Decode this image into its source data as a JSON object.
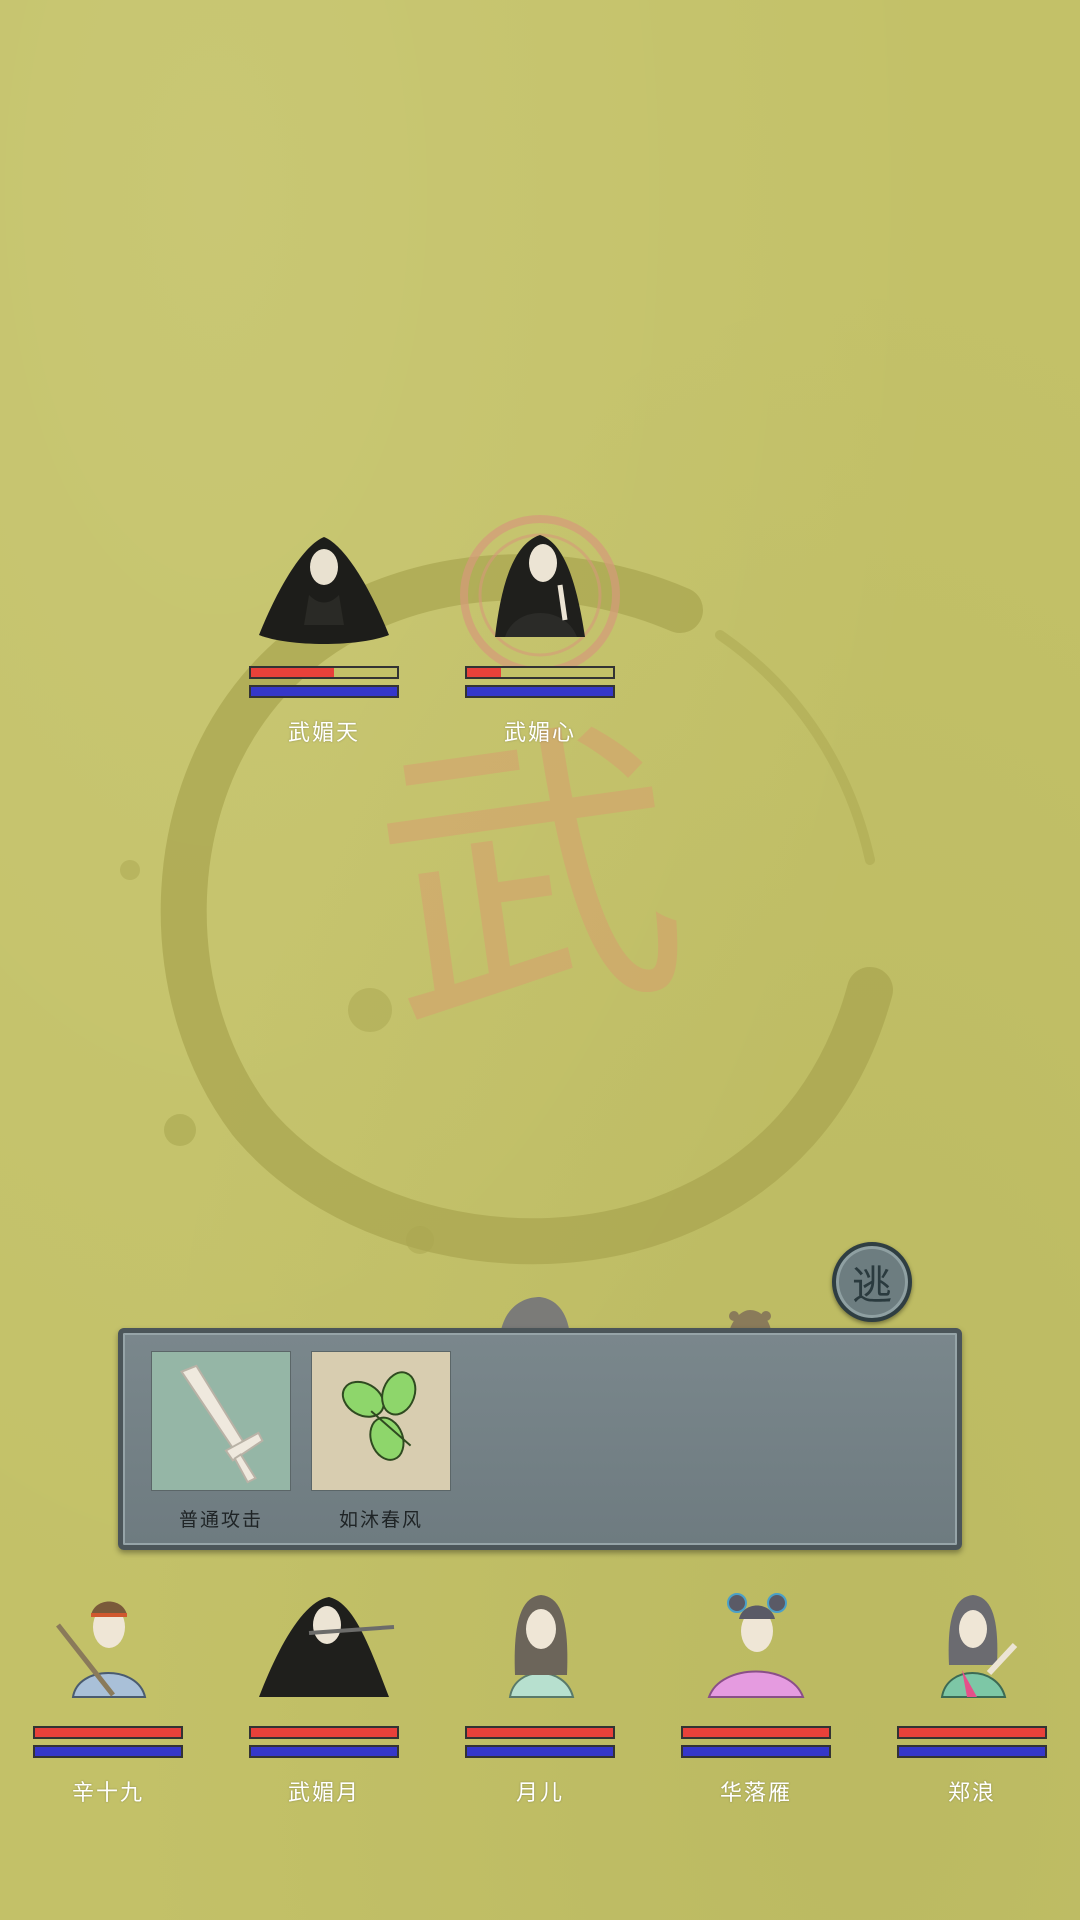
{
  "enemies": [
    {
      "name": "武媚天",
      "hp": 0.57,
      "mp": 1.0,
      "portrait": "veiled-woman-black-hair-portrait"
    },
    {
      "name": "武媚心",
      "hp": 0.23,
      "mp": 1.0,
      "portrait": "long-black-hair-woman-portrait"
    }
  ],
  "party": [
    {
      "name": "辛十九",
      "hp": 1.0,
      "mp": 1.0,
      "portrait": "swordsman-headband-portrait"
    },
    {
      "name": "武媚月",
      "hp": 1.0,
      "mp": 1.0,
      "portrait": "flute-player-black-robe-portrait"
    },
    {
      "name": "月儿",
      "hp": 1.0,
      "mp": 1.0,
      "portrait": "girl-long-hair-green-robe-portrait"
    },
    {
      "name": "华落雁",
      "hp": 1.0,
      "mp": 1.0,
      "portrait": "girl-twin-buns-pink-robe-portrait"
    },
    {
      "name": "郑浪",
      "hp": 1.0,
      "mp": 1.0,
      "portrait": "youth-pink-green-robe-portrait"
    }
  ],
  "skills": [
    {
      "label": "普通攻击",
      "icon": "sword-icon"
    },
    {
      "label": "如沐春风",
      "icon": "green-leaves-icon"
    }
  ],
  "escape": {
    "label": "逃"
  },
  "background": {
    "glyph": "武"
  },
  "colors": {
    "background": "#c3c168",
    "hp": "#e8413a",
    "mp": "#3537c9",
    "panel": "#75838a"
  }
}
